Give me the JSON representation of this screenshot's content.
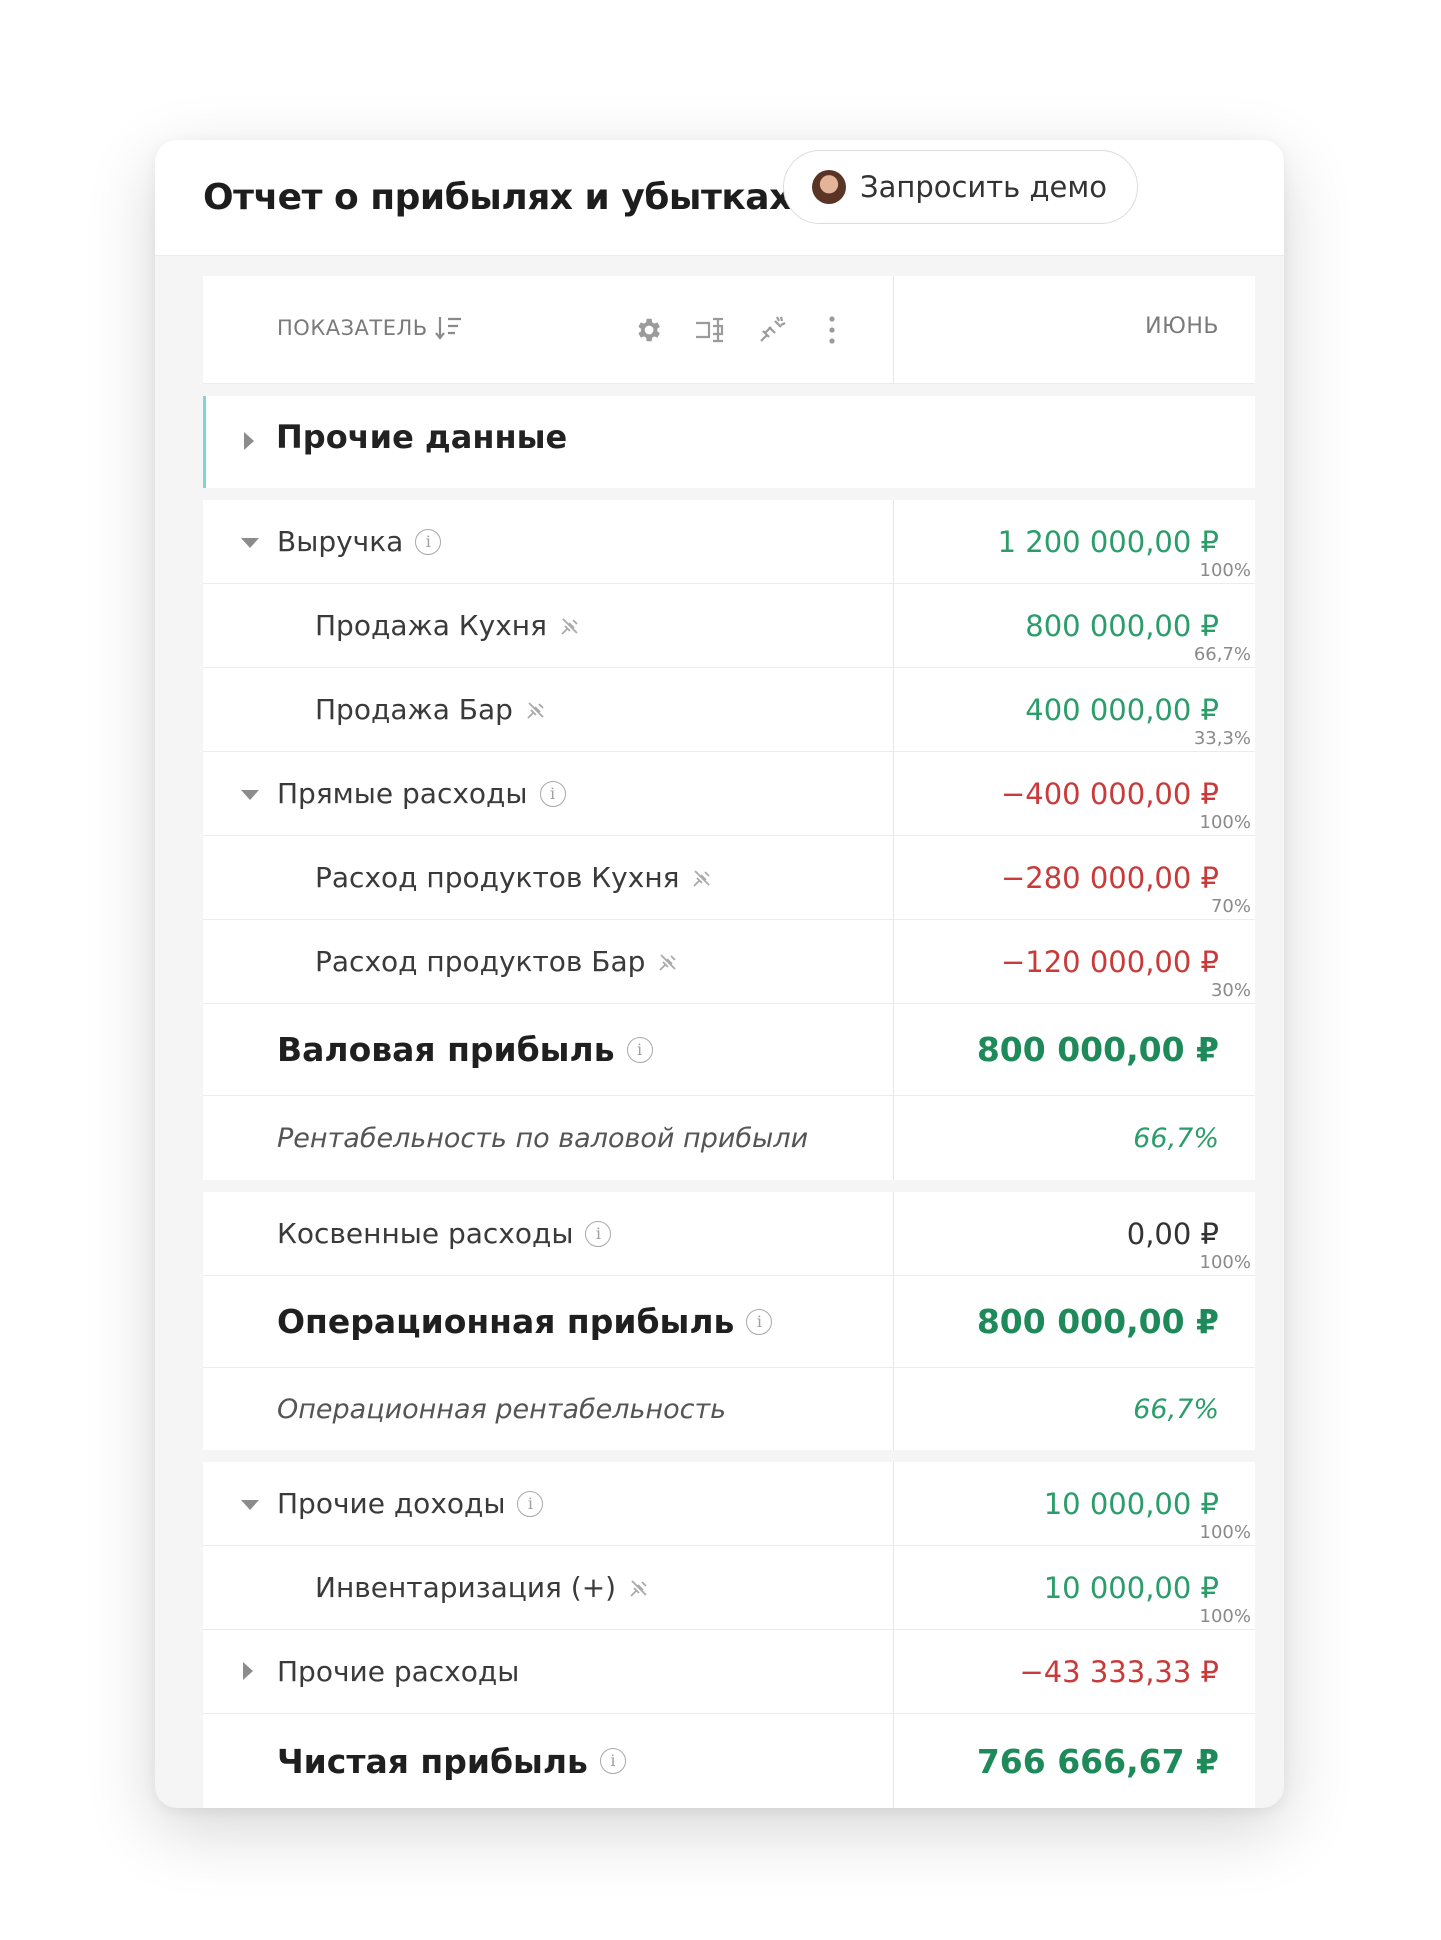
{
  "header": {
    "title": "Отчет о прибылях и убытках",
    "demo_button": "Запросить демо"
  },
  "table": {
    "column_indicator": "ПОКАЗАТЕЛЬ",
    "column_month": "ИЮНЬ",
    "group_title": "Прочие данные",
    "rows": [
      {
        "label": "Выручка",
        "value": "1 200 000,00 ₽",
        "pct": "100%"
      },
      {
        "label": "Продажа Кухня",
        "value": "800 000,00 ₽",
        "pct": "66,7%"
      },
      {
        "label": "Продажа Бар",
        "value": "400 000,00 ₽",
        "pct": "33,3%"
      },
      {
        "label": "Прямые расходы",
        "value": "−400 000,00 ₽",
        "pct": "100%"
      },
      {
        "label": "Расход продуктов Кухня",
        "value": "−280 000,00 ₽",
        "pct": "70%"
      },
      {
        "label": "Расход продуктов Бар",
        "value": "−120 000,00 ₽",
        "pct": "30%"
      },
      {
        "label": "Валовая прибыль",
        "value": "800 000,00 ₽"
      },
      {
        "label": "Рентабельность по валовой прибыли",
        "value": "66,7%"
      },
      {
        "label": "Косвенные расходы",
        "value": "0,00 ₽",
        "pct": "100%"
      },
      {
        "label": "Операционная прибыль",
        "value": "800 000,00 ₽"
      },
      {
        "label": "Операционная рентабельность",
        "value": "66,7%"
      },
      {
        "label": "Прочие доходы",
        "value": "10 000,00 ₽",
        "pct": "100%"
      },
      {
        "label": "Инвентаризация (+)",
        "value": "10 000,00 ₽",
        "pct": "100%"
      },
      {
        "label": "Прочие расходы",
        "value": "−43 333,33 ₽"
      },
      {
        "label": "Чистая прибыль",
        "value": "766 666,67 ₽"
      }
    ]
  },
  "colors": {
    "positive": "#2a9d6a",
    "negative": "#c93a3a",
    "group_accent": "#7fd6da"
  },
  "icons": [
    "avatar",
    "sort-icon",
    "gear-icon",
    "column-split-icon",
    "unlink-icon",
    "more-vertical-icon",
    "info-icon",
    "chevron-right-icon",
    "chevron-down-icon"
  ]
}
